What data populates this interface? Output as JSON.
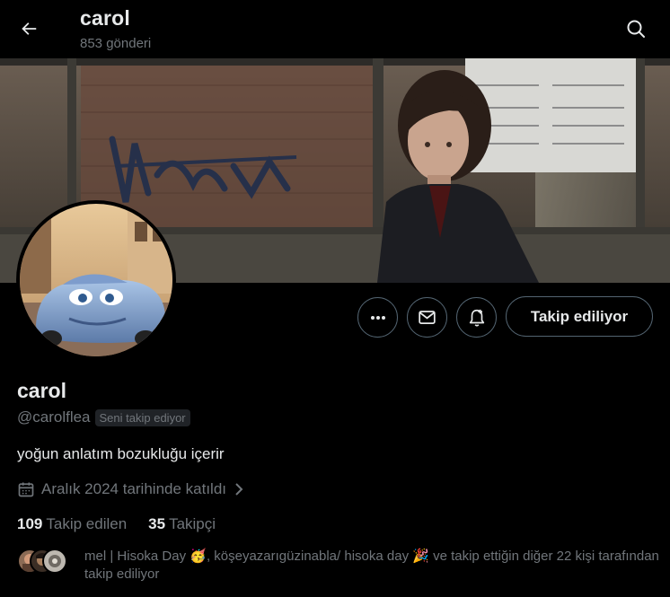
{
  "header": {
    "title": "carol",
    "post_count": "853 gönderi"
  },
  "profile": {
    "name": "carol",
    "handle": "@carolflea",
    "follows_you": "Seni takip ediyor",
    "bio": "yoğun anlatım bozukluğu içerir",
    "joined": "Aralık 2024 tarihinde katıldı",
    "following_count": "109",
    "following_label": "Takip edilen",
    "followers_count": "35",
    "followers_label": "Takipçi"
  },
  "actions": {
    "follow_state": "Takip ediliyor"
  },
  "known_followers": {
    "text": "mel | Hisoka Day 🥳, köşeyazarıgüzinabla/ hisoka day 🎉 ve takip ettiğin diğer 22 kişi tarafından takip ediliyor"
  },
  "icons": [
    "back-arrow-icon",
    "search-icon",
    "more-icon",
    "mail-icon",
    "notification-bell-icon",
    "calendar-icon",
    "chevron-right-icon"
  ],
  "colors": {
    "background": "#000000",
    "text_primary": "#e7e9ea",
    "text_secondary": "#71767b",
    "border": "#536471"
  }
}
